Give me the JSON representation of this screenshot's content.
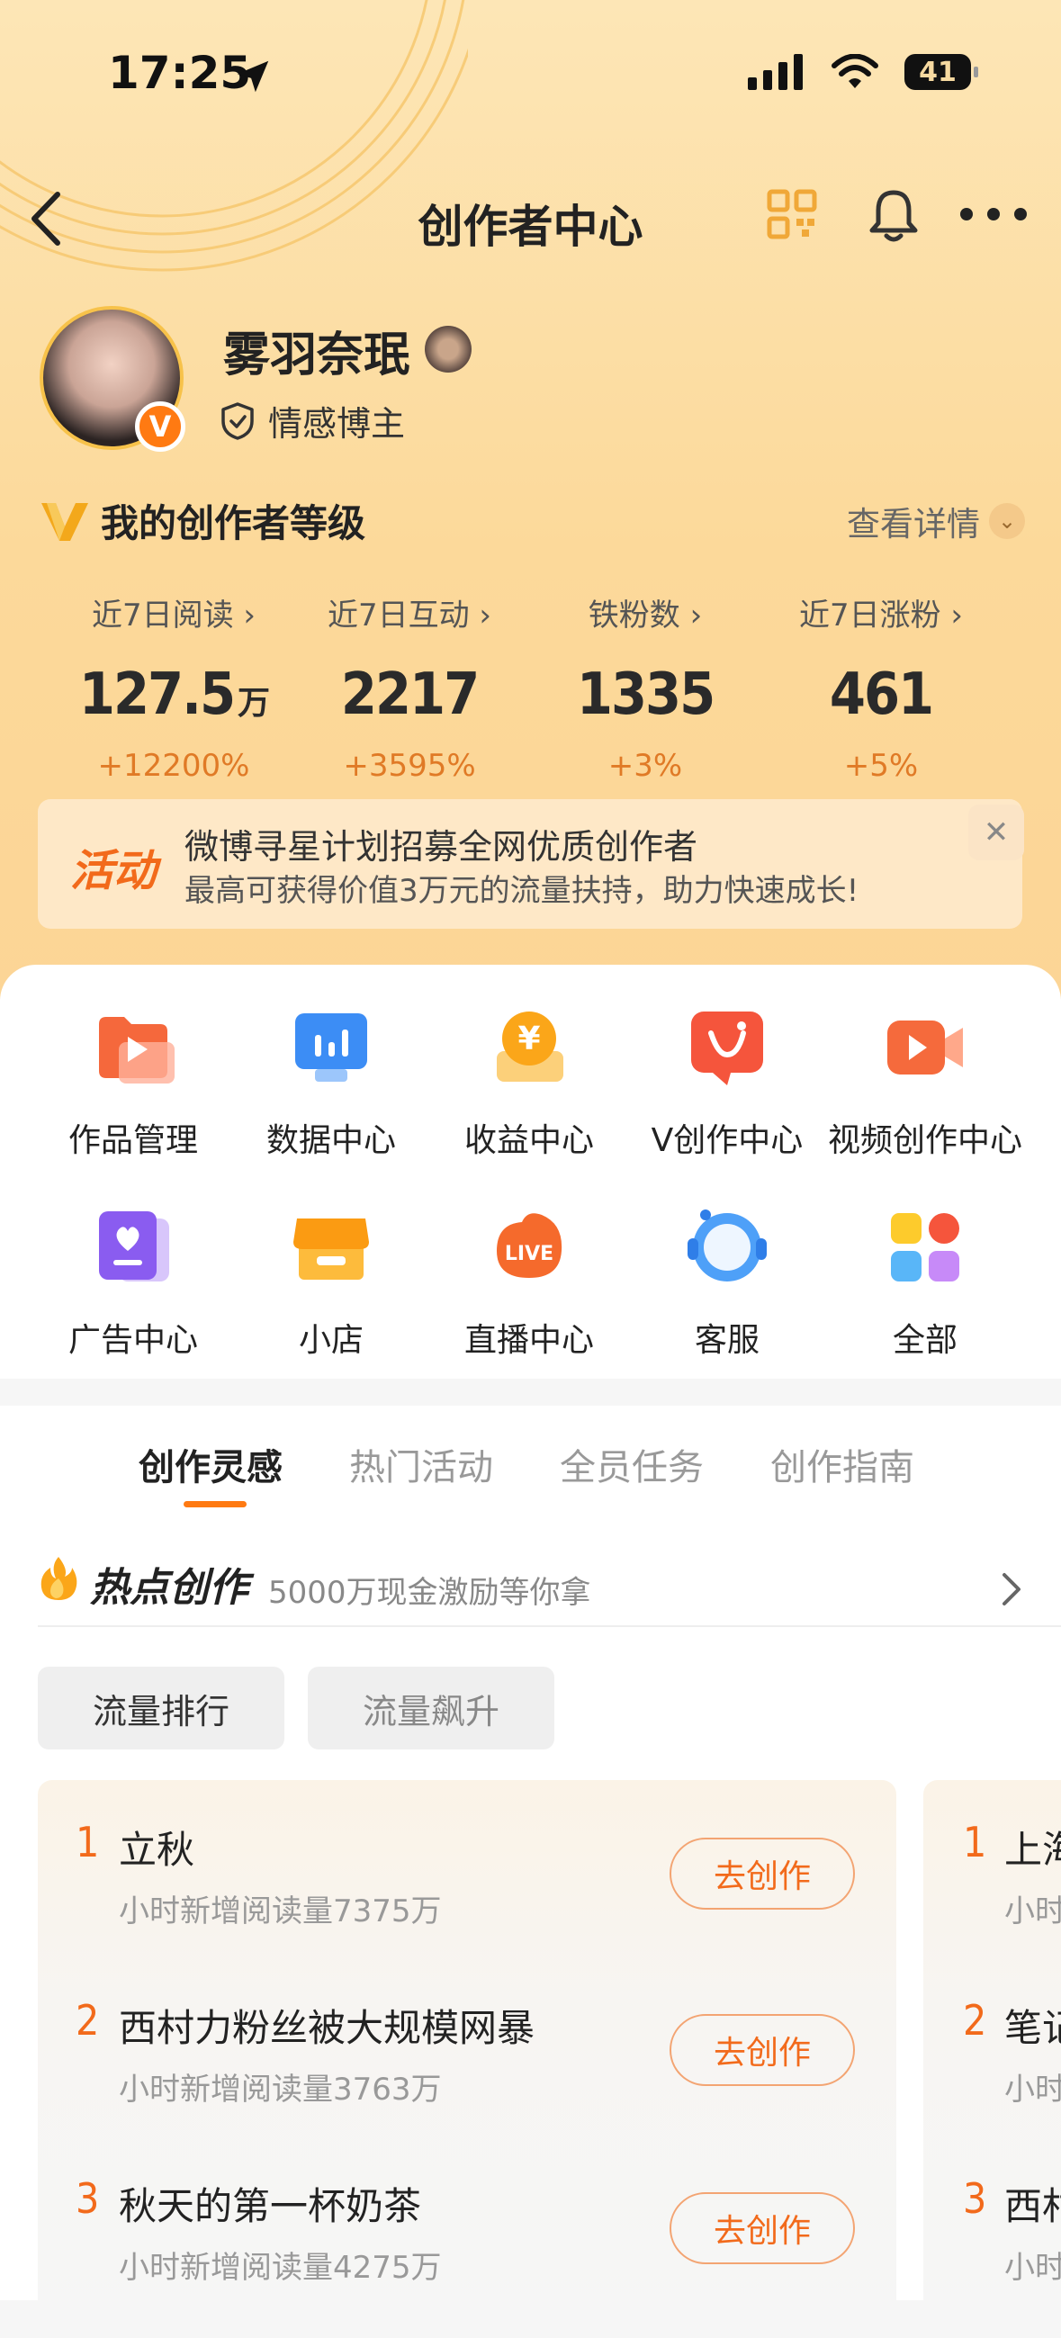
{
  "status_bar": {
    "time": "17:25",
    "battery": "41"
  },
  "nav": {
    "title": "创作者中心"
  },
  "profile": {
    "name": "雾羽奈珉",
    "badge_letter": "V",
    "tagline": "情感博主"
  },
  "level": {
    "title": "我的创作者等级",
    "detail_label": "查看详情"
  },
  "stats": [
    {
      "label": "近7日阅读",
      "value": "127.5",
      "unit": "万",
      "delta": "+12200%"
    },
    {
      "label": "近7日互动",
      "value": "2217",
      "unit": "",
      "delta": "+3595%"
    },
    {
      "label": "铁粉数",
      "value": "1335",
      "unit": "",
      "delta": "+3%"
    },
    {
      "label": "近7日涨粉",
      "value": "461",
      "unit": "",
      "delta": "+5%"
    }
  ],
  "banner": {
    "tag": "活动",
    "title": "微博寻星计划招募全网优质创作者",
    "subtitle": "最高可获得价值3万元的流量扶持，助力快速成长!"
  },
  "tools": [
    {
      "label": "作品管理",
      "icon": "folder-play-icon"
    },
    {
      "label": "数据中心",
      "icon": "chart-screen-icon"
    },
    {
      "label": "收益中心",
      "icon": "coin-yen-icon"
    },
    {
      "label": "V创作中心",
      "icon": "v-create-icon"
    },
    {
      "label": "视频创作中心",
      "icon": "video-camera-icon"
    },
    {
      "label": "广告中心",
      "icon": "ad-heart-icon"
    },
    {
      "label": "小店",
      "icon": "shop-icon"
    },
    {
      "label": "直播中心",
      "icon": "live-icon"
    },
    {
      "label": "客服",
      "icon": "headset-icon"
    },
    {
      "label": "全部",
      "icon": "grid-all-icon"
    }
  ],
  "tabs": [
    "创作灵感",
    "热门活动",
    "全员任务",
    "创作指南"
  ],
  "hot": {
    "title": "热点创作",
    "subtitle": "5000万现金激励等你拿"
  },
  "chips": [
    "流量排行",
    "流量飙升"
  ],
  "rank_list": [
    {
      "rank": "1",
      "title": "立秋",
      "sub": "小时新增阅读量7375万",
      "action": "去创作"
    },
    {
      "rank": "2",
      "title": "西村力粉丝被大规模网暴",
      "sub": "小时新增阅读量3763万",
      "action": "去创作"
    },
    {
      "rank": "3",
      "title": "秋天的第一杯奶茶",
      "sub": "小时新增阅读量4275万",
      "action": "去创作"
    }
  ],
  "rank_list_2": [
    {
      "rank": "1",
      "title": "上海",
      "sub": "小时"
    },
    {
      "rank": "2",
      "title": "笔记",
      "sub": "小时"
    },
    {
      "rank": "3",
      "title": "西村",
      "sub": "小时"
    }
  ],
  "colors": {
    "accent": "#f26a1b",
    "header_bg": "#fcd99a"
  }
}
